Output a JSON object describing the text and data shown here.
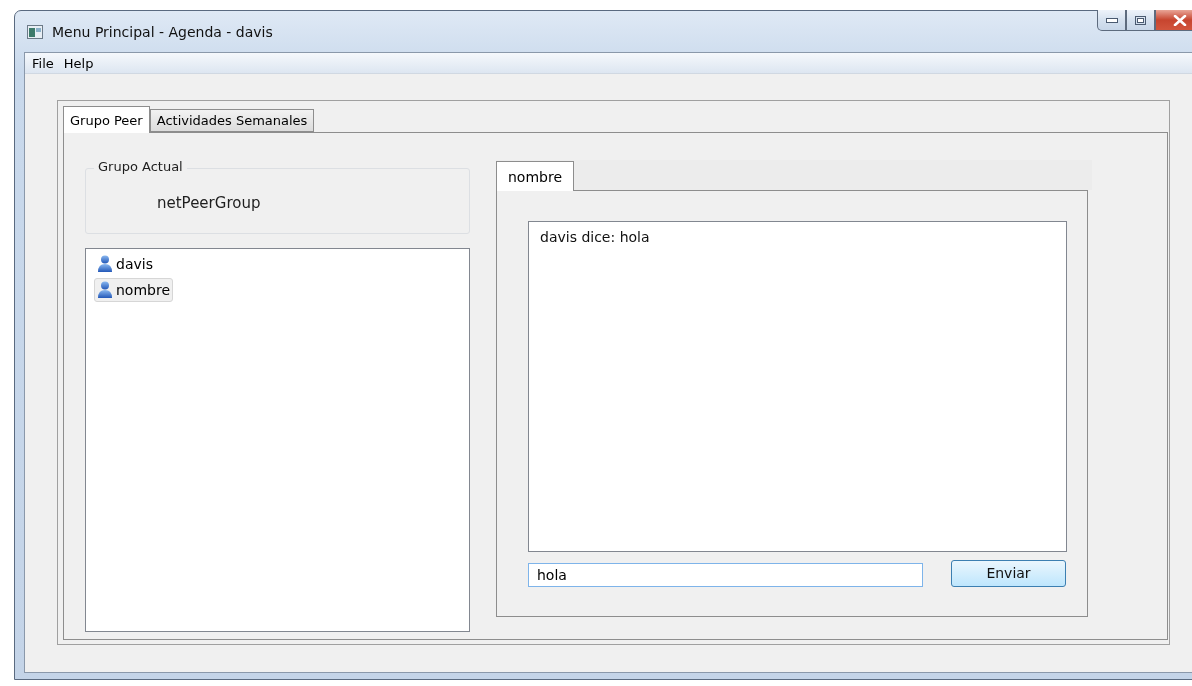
{
  "window": {
    "title": "Menu Principal - Agenda - davis"
  },
  "menu": [
    "File",
    "Help"
  ],
  "tabs": [
    {
      "label": "Grupo Peer",
      "selected": true
    },
    {
      "label": "Actividades Semanales",
      "selected": false
    }
  ],
  "group": {
    "title": "Grupo Actual",
    "value": "netPeerGroup"
  },
  "users": [
    {
      "name": "davis",
      "selected": false
    },
    {
      "name": "nombre",
      "selected": true
    }
  ],
  "chat_tabs": [
    {
      "label": "nombre",
      "selected": true
    }
  ],
  "messages": [
    "davis dice: hola"
  ],
  "message_input": {
    "value": "hola"
  },
  "send_button": "Enviar"
}
